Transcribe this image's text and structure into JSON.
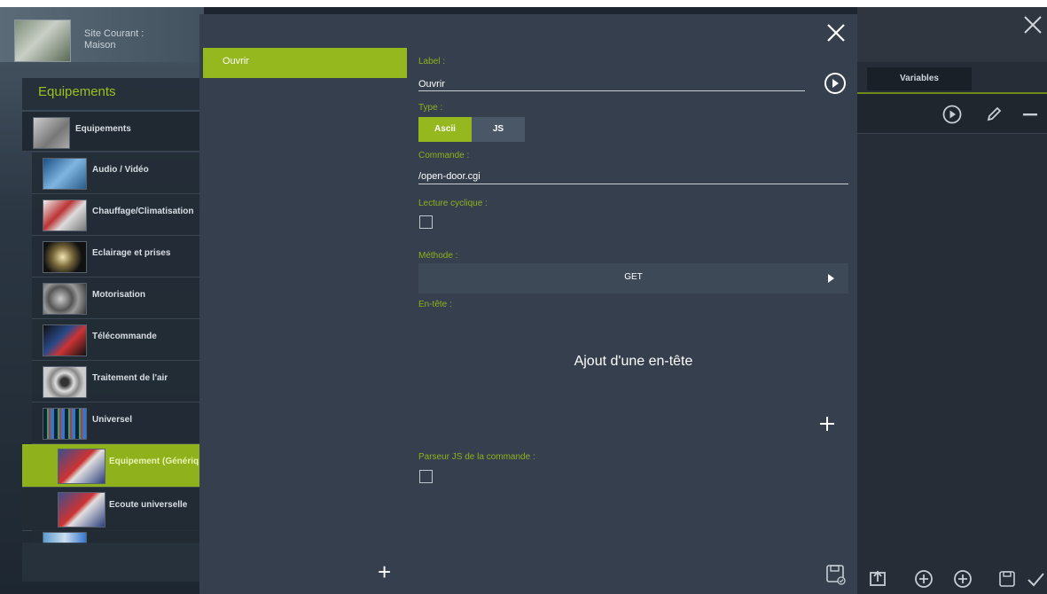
{
  "site": {
    "label_line1": "Site Courant :",
    "label_line2": "Maison"
  },
  "equipements": {
    "title": "Equipements",
    "root": {
      "label": "Equipements"
    },
    "categories": [
      {
        "label": "Audio / Vidéo"
      },
      {
        "label": "Chauffage/Climatisation"
      },
      {
        "label": "Eclairage et prises"
      },
      {
        "label": "Motorisation"
      },
      {
        "label": "Télécommande"
      },
      {
        "label": "Traitement de l'air"
      },
      {
        "label": "Universel"
      }
    ],
    "sub_items": [
      {
        "label": "Equipement (Génériq",
        "active": true
      },
      {
        "label": "Ecoute universelle",
        "active": false
      }
    ]
  },
  "background_panel": {
    "tab_variables": "Variables"
  },
  "modal": {
    "commands": [
      {
        "label": "Ouvrir"
      }
    ],
    "label_field": {
      "label": "Label :",
      "value": "Ouvrir"
    },
    "type": {
      "label": "Type :",
      "options": [
        "Ascii",
        "JS"
      ],
      "selected": "Ascii"
    },
    "commande": {
      "label": "Commande :",
      "value": "/open-door.cgi"
    },
    "lecture_cyclique": {
      "label": "Lecture cyclique :",
      "checked": false
    },
    "methode": {
      "label": "Méthode :",
      "value": "GET"
    },
    "entete": {
      "label": "En-tête :",
      "add_text": "Ajout d'une en-tête"
    },
    "parseur": {
      "label": "Parseur JS de la commande :",
      "checked": false
    }
  },
  "colors": {
    "accent": "#95b81f",
    "modal_bg": "#353f4e",
    "select_bg": "#3e4958"
  }
}
